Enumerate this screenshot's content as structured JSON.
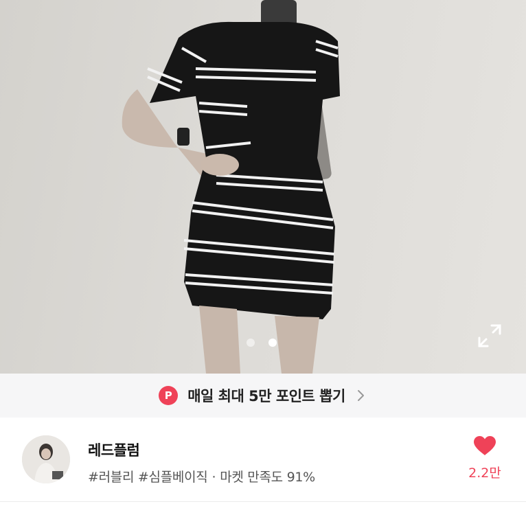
{
  "hero": {
    "image_alt": "Black and white striped knit mini dress product photo",
    "slide_index": 2,
    "slide_total": 2,
    "expand_icon": "expand-icon"
  },
  "promo": {
    "badge": "P",
    "text": "매일 최대 5만 포인트 뽑기",
    "badge_color": "#ef4258"
  },
  "seller": {
    "name": "레드플럼",
    "tag1": "#러블리",
    "tag2": "#심플베이직",
    "separator": "·",
    "satisfaction": "마켓 만족도 91%"
  },
  "like": {
    "count": "2.2만",
    "color": "#ef4258"
  }
}
